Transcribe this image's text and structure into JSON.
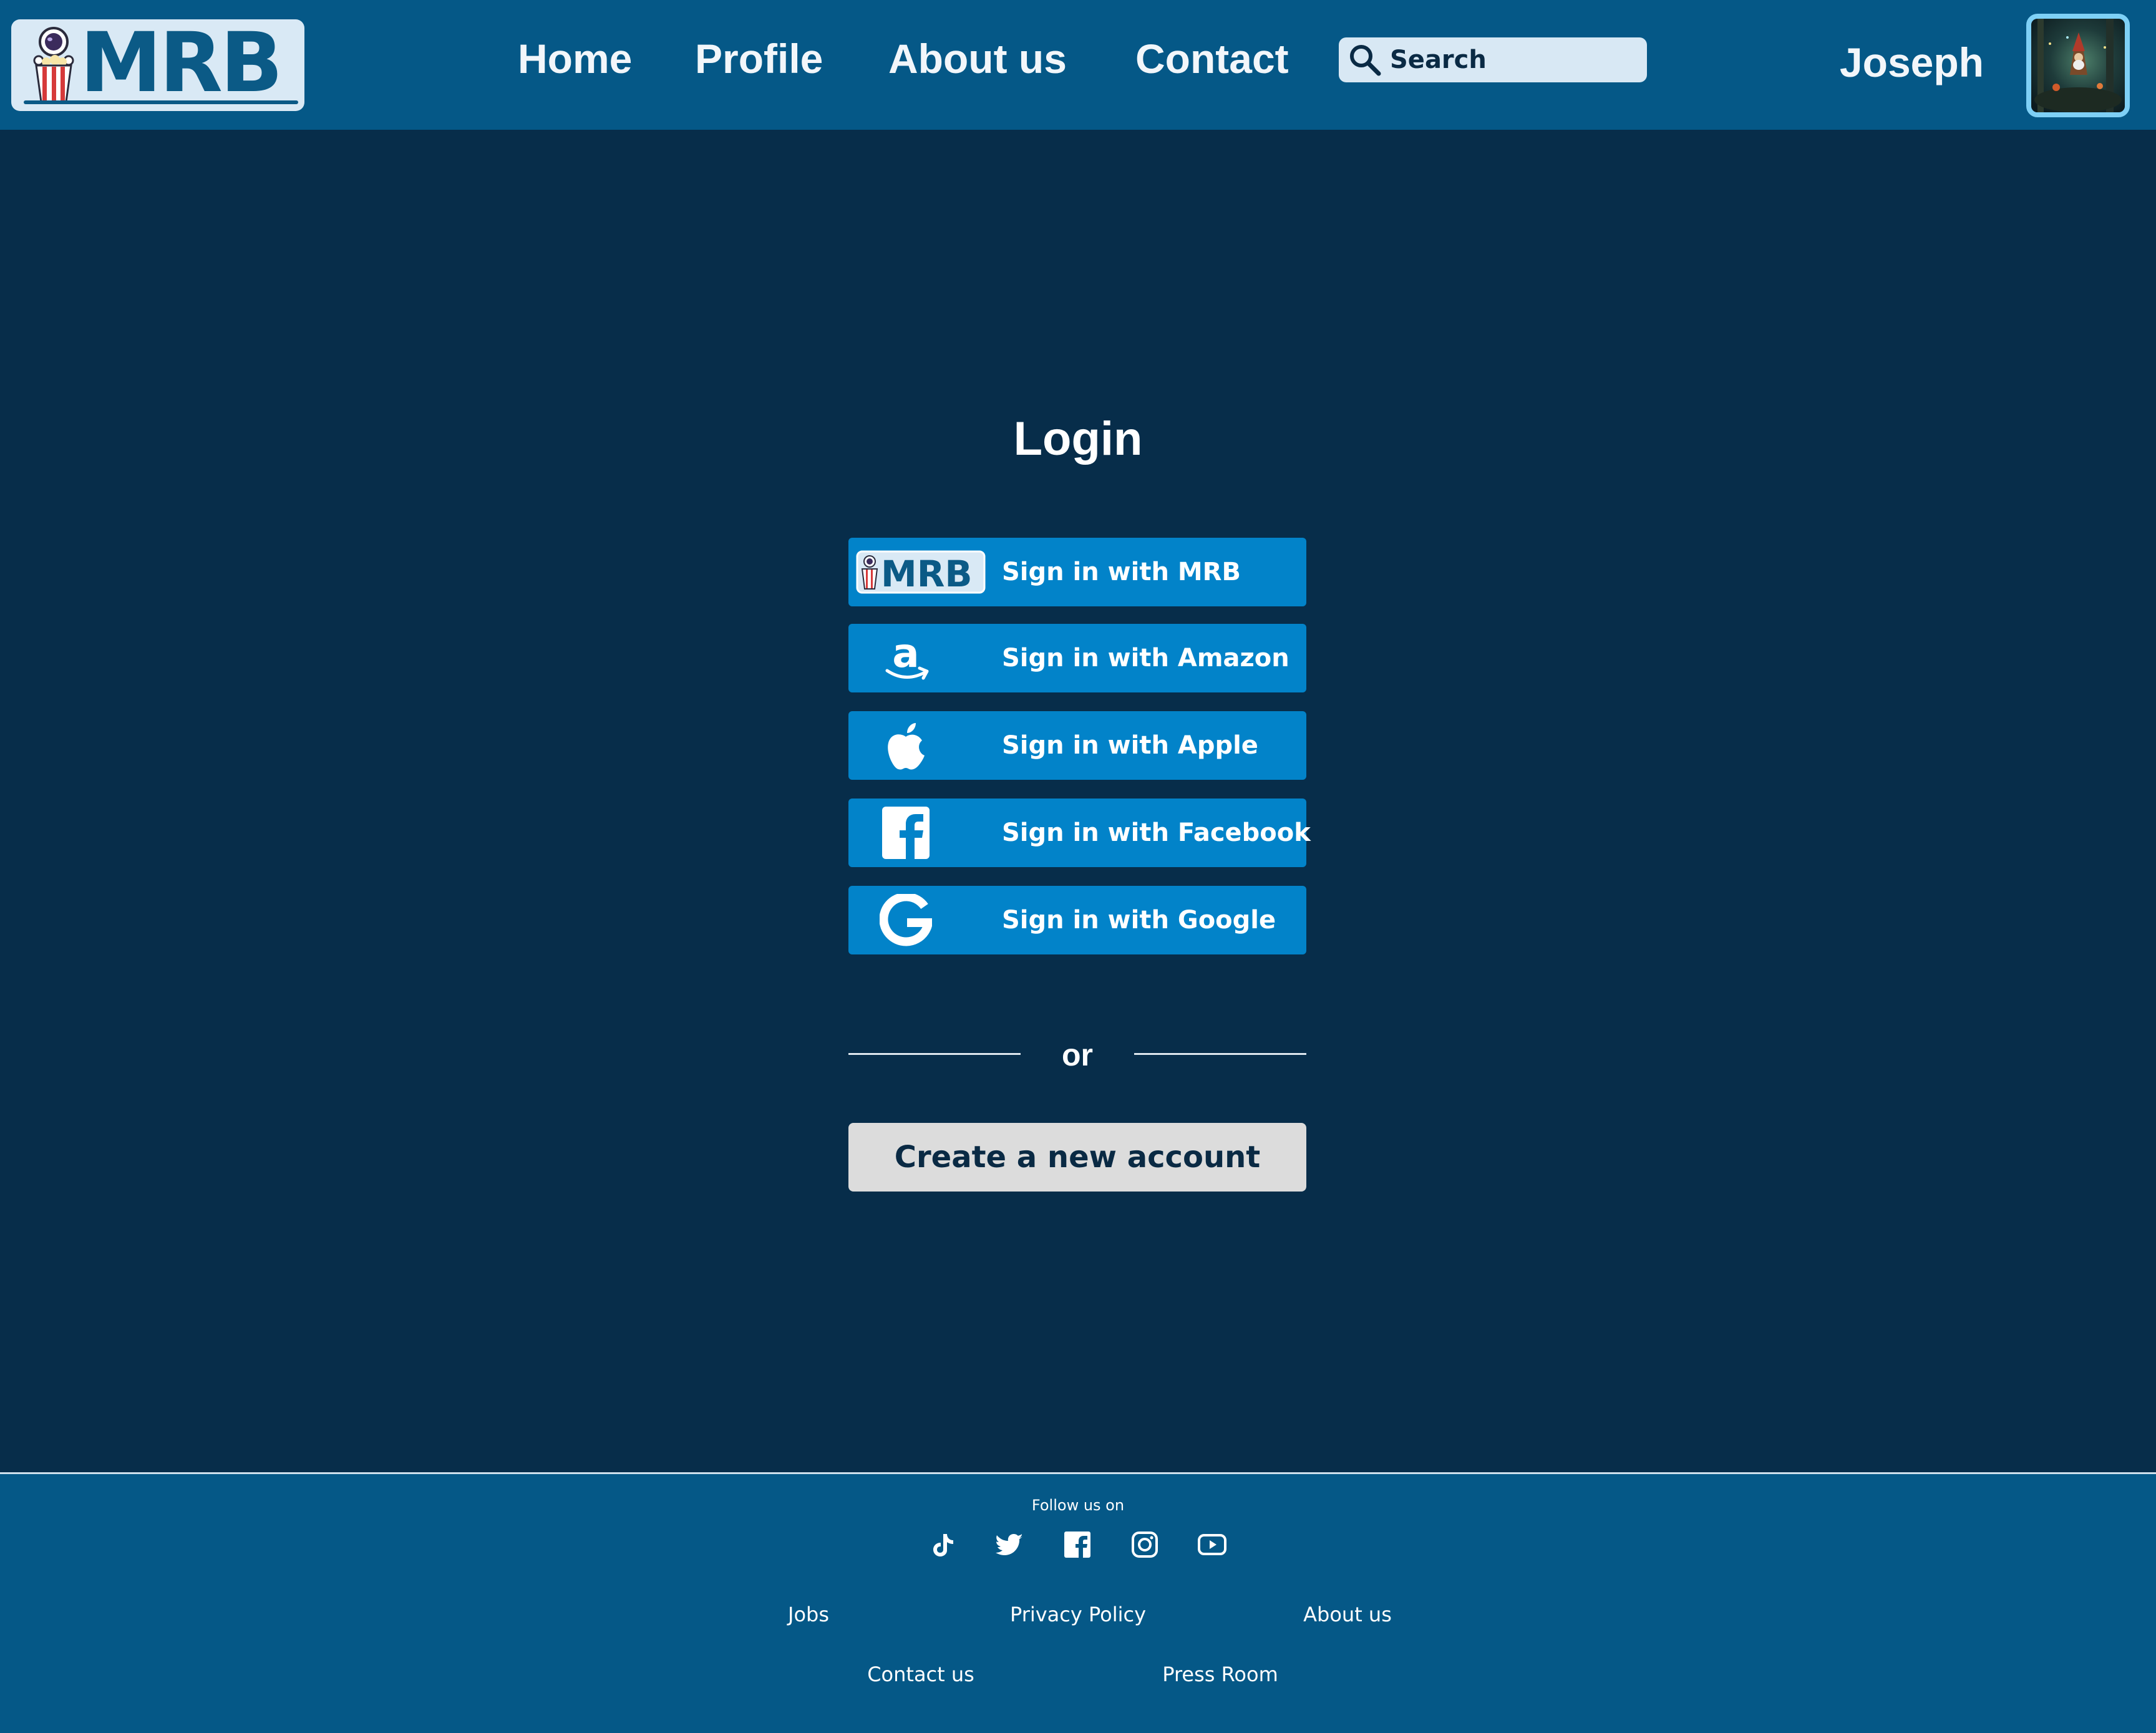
{
  "header": {
    "logo_text": "MRB",
    "nav": {
      "home": "Home",
      "profile": "Profile",
      "about": "About us",
      "contact": "Contact"
    },
    "search": {
      "placeholder": "Search",
      "value": ""
    },
    "user_name": "Joseph",
    "avatar_alt": "Joseph"
  },
  "login": {
    "title": "Login",
    "providers": [
      {
        "label": "Sign in with MRB",
        "icon": "mrb-logo-icon"
      },
      {
        "label": "Sign in with Amazon",
        "icon": "amazon-icon"
      },
      {
        "label": "Sign in with Apple",
        "icon": "apple-icon"
      },
      {
        "label": "Sign in with Facebook",
        "icon": "facebook-icon"
      },
      {
        "label": "Sign in with Google",
        "icon": "google-icon"
      }
    ],
    "divider_text": "or",
    "create_account_label": "Create a new account"
  },
  "footer": {
    "follow_text": "Follow us on",
    "social": [
      "tiktok-icon",
      "twitter-icon",
      "facebook-icon",
      "instagram-icon",
      "youtube-icon"
    ],
    "links": {
      "jobs": "Jobs",
      "privacy": "Privacy Policy",
      "about": "About us",
      "contact": "Contact us",
      "press": "Press Room"
    }
  },
  "colors": {
    "header_bg": "#055887",
    "page_bg": "#072d4a",
    "button_blue": "#0283c9",
    "create_button_bg": "#dcdcdc",
    "avatar_border": "#7ed0f6"
  }
}
